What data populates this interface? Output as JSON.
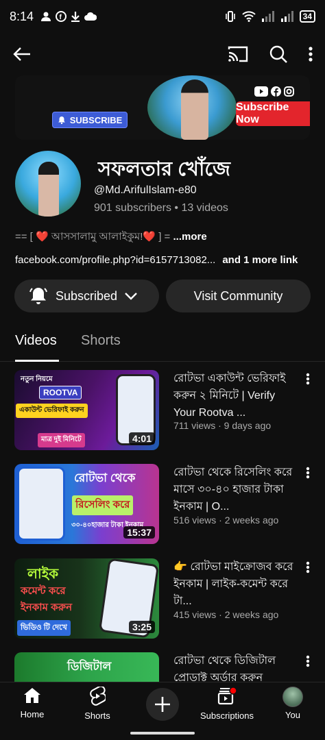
{
  "status_bar": {
    "time": "8:14",
    "battery": "34"
  },
  "banner": {
    "subscribe_label": "SUBSCRIBE",
    "subscribe_now_label": "Subscribe Now"
  },
  "channel": {
    "name": "সফলতার খোঁজে",
    "handle": "@Md.ArifulIslam-e80",
    "stats": "901 subscribers • 13 videos",
    "description": "== [ ❤️ আসসালামু আলাইকুম!❤️ ] = ",
    "description_more": "...more",
    "link": "facebook.com/profile.php?id=6157713082...",
    "link_extra": "and 1 more link"
  },
  "buttons": {
    "subscribed": "Subscribed",
    "community": "Visit Community"
  },
  "tabs": [
    {
      "label": "Videos",
      "active": true
    },
    {
      "label": "Shorts",
      "active": false
    }
  ],
  "videos": [
    {
      "title": "রোটভা একাউন্ট ভেরিফাই করুন ২ মিনিটে | Verify Your Rootva ...",
      "meta": "711 views · 9 days ago",
      "duration": "4:01",
      "thumb_text": [
        "নতুন নিয়মে",
        "ROOTVA",
        "একাউন্ট ভেরিফাই করুন",
        "মাত্র দুই মিনিটে"
      ]
    },
    {
      "title": "রোটভা থেকে রিসেলিং করে মাসে ৩০-৪০ হাজার টাকা ইনকাম | O...",
      "meta": "516 views · 2 weeks ago",
      "duration": "15:37",
      "thumb_text": [
        "রোটভা থেকে",
        "রিসেলিং করে",
        "৩০-৪০হাজার টাকা ইনকাম"
      ]
    },
    {
      "title": "👉 রোটভা মাইক্রোজব করে ইনকাম | লাইক-কমেন্ট করে টা...",
      "meta": "415 views · 2 weeks ago",
      "duration": "3:25",
      "thumb_text": [
        "লাইক",
        "কমেন্ট করে",
        "ইনকাম করুন",
        "ভিডিও টি দেখে"
      ]
    },
    {
      "title": "রোটভা থেকে ডিজিটাল প্রোডাক্ট অর্ডার করুন",
      "meta": "",
      "duration": "",
      "thumb_text": [
        "ডিজিটাল"
      ]
    }
  ],
  "bottom_nav": {
    "home": "Home",
    "shorts": "Shorts",
    "subscriptions": "Subscriptions",
    "you": "You"
  }
}
